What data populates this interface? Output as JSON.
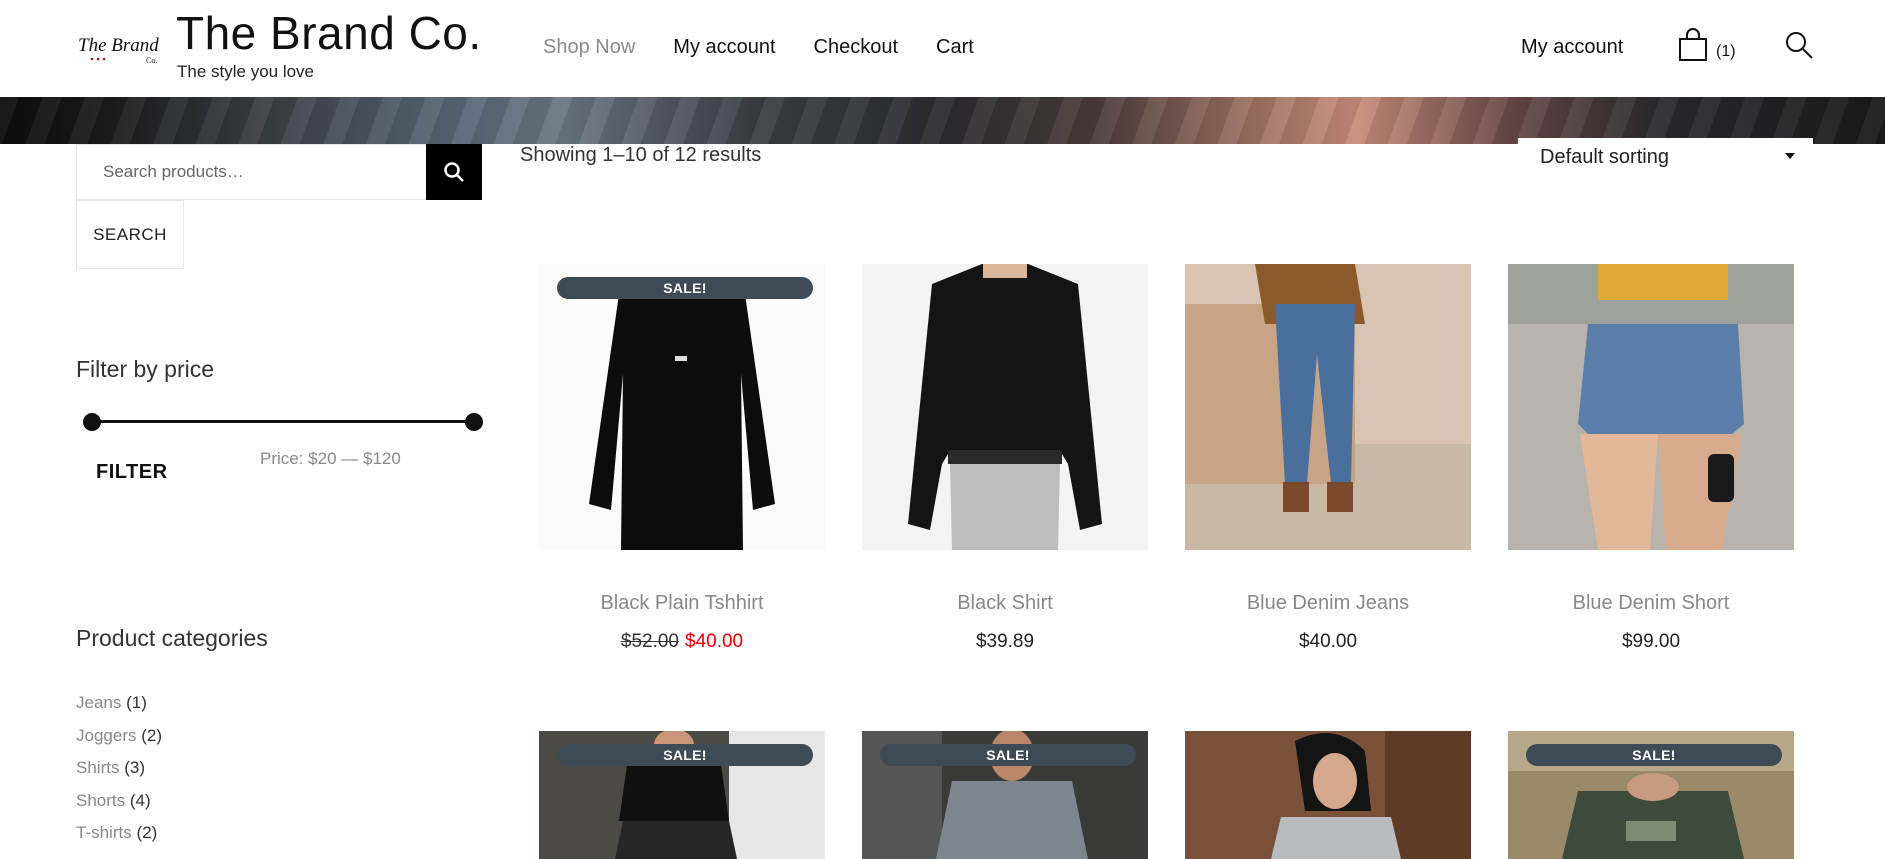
{
  "header": {
    "site_title": "The Brand Co.",
    "tagline": "The style you love",
    "logo_text_top": "The Brand",
    "logo_text_bottom": "Co.",
    "nav": [
      "Shop Now",
      "My account",
      "Checkout",
      "Cart"
    ],
    "account_label": "My account",
    "cart_count": "(1)"
  },
  "sidebar": {
    "search_placeholder": "Search products…",
    "search_submit": "SEARCH",
    "filter_title": "Filter by price",
    "filter_button": "FILTER",
    "price_label": "Price: $20 — $120",
    "categories_title": "Product categories",
    "categories": [
      {
        "name": "Jeans",
        "count": "(1)"
      },
      {
        "name": "Joggers",
        "count": "(2)"
      },
      {
        "name": "Shirts",
        "count": "(3)"
      },
      {
        "name": "Shorts",
        "count": "(4)"
      },
      {
        "name": "T-shirts",
        "count": "(2)"
      }
    ]
  },
  "main": {
    "result_count": "Showing 1–10 of 12 results",
    "sorting": "Default sorting",
    "sale_label": "SALE!",
    "products": [
      {
        "title": "Black Plain Tshhirt",
        "regular_price": "$52.00",
        "price": "$40.00",
        "on_sale": true
      },
      {
        "title": "Black Shirt",
        "price": "$39.89",
        "on_sale": false
      },
      {
        "title": "Blue Denim Jeans",
        "price": "$40.00",
        "on_sale": false
      },
      {
        "title": "Blue Denim Short",
        "price": "$99.00",
        "on_sale": false
      }
    ],
    "row2_sale_flags": [
      true,
      true,
      false,
      true
    ]
  },
  "colors": {
    "sale_badge": "#3e4a56",
    "sale_price": "#e20000",
    "muted_text": "#888888",
    "search_button": "#000000"
  },
  "icons": [
    "logo",
    "cart-icon",
    "search-icon",
    "magnifier-icon"
  ]
}
